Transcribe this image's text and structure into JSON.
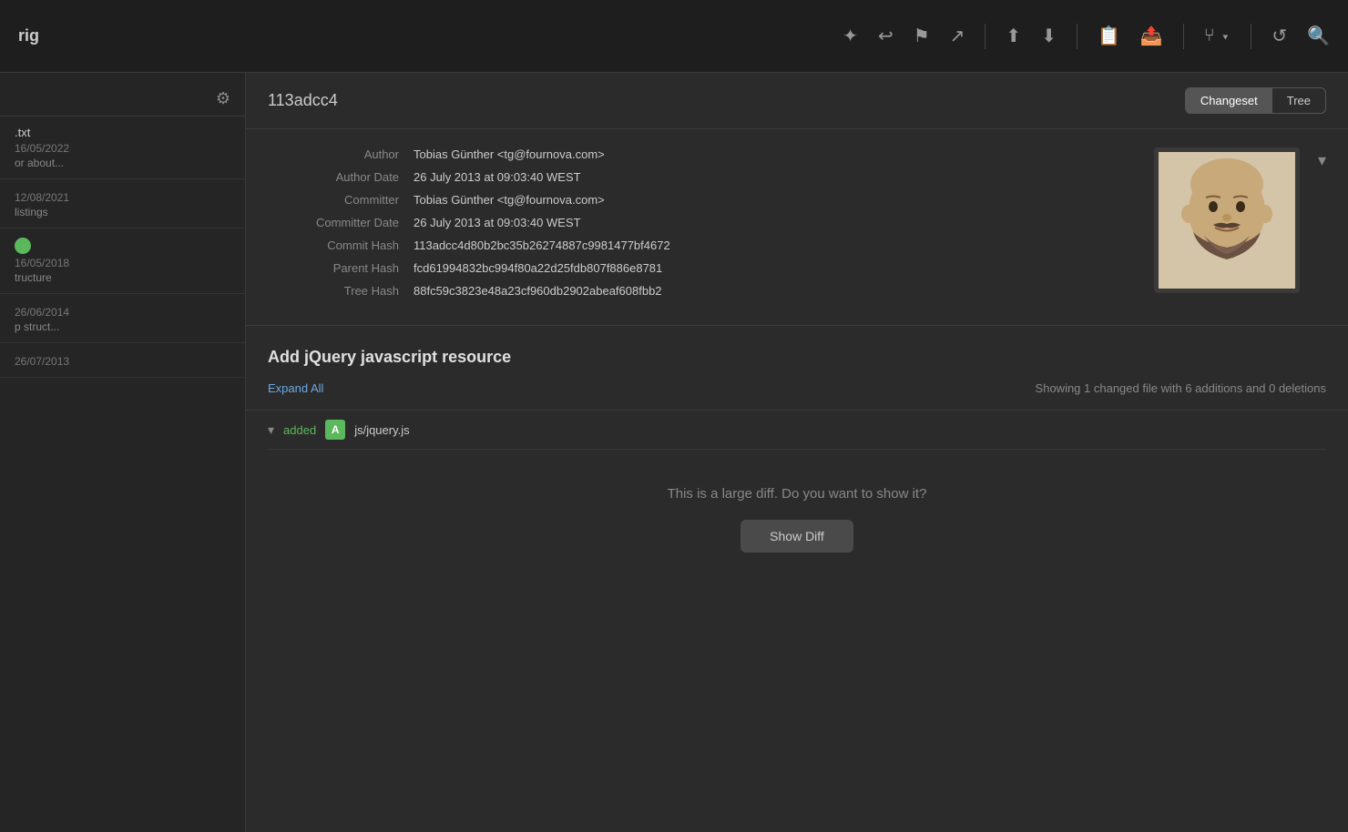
{
  "app": {
    "title": "rig"
  },
  "toolbar": {
    "icons": [
      {
        "name": "magic-wand-icon",
        "symbol": "✦"
      },
      {
        "name": "undo-icon",
        "symbol": "↩"
      },
      {
        "name": "flag-icon",
        "symbol": "⚑"
      },
      {
        "name": "merge-icon",
        "symbol": "↗"
      },
      {
        "name": "branch-up-icon",
        "symbol": "⬆"
      },
      {
        "name": "branch-down-icon",
        "symbol": "⬇"
      },
      {
        "name": "stash-icon",
        "symbol": "📋"
      },
      {
        "name": "push-icon",
        "symbol": "📤"
      },
      {
        "name": "branch-icon",
        "symbol": "⑂"
      },
      {
        "name": "refresh-icon",
        "symbol": "↺"
      },
      {
        "name": "search-icon",
        "symbol": "🔍"
      }
    ]
  },
  "sidebar": {
    "items": [
      {
        "id": 1,
        "title": ".txt",
        "date": "16/05/2022",
        "desc": "or about..."
      },
      {
        "id": 2,
        "title": "",
        "date": "12/08/2021",
        "desc": "listings"
      },
      {
        "id": 3,
        "title": "",
        "date": "16/05/2018",
        "desc": "tructure"
      },
      {
        "id": 4,
        "title": "",
        "date": "26/06/2014",
        "desc": "p struct..."
      },
      {
        "id": 5,
        "title": "",
        "date": "26/07/2013",
        "desc": ""
      }
    ]
  },
  "commit": {
    "hash": "113adcc4",
    "author_label": "Author",
    "author_value": "Tobias Günther <tg@fournova.com>",
    "author_date_label": "Author Date",
    "author_date_value": "26 July 2013 at 09:03:40 WEST",
    "committer_label": "Committer",
    "committer_value": "Tobias Günther <tg@fournova.com>",
    "committer_date_label": "Committer Date",
    "committer_date_value": "26 July 2013 at 09:03:40 WEST",
    "commit_hash_label": "Commit Hash",
    "commit_hash_value": "113adcc4d80b2bc35b26274887c9981477bf4672",
    "parent_hash_label": "Parent Hash",
    "parent_hash_value": "fcd61994832bc994f80a22d25fdb807f886e8781",
    "tree_hash_label": "Tree Hash",
    "tree_hash_value": "88fc59c3823e48a23cf960db2902abeaf608fbb2",
    "message": "Add jQuery javascript resource",
    "diff_summary": "Showing 1 changed file with 6 additions and 0 deletions",
    "expand_all": "Expand All"
  },
  "view_toggle": {
    "changeset_label": "Changeset",
    "tree_label": "Tree",
    "active": "changeset"
  },
  "file_diff": {
    "status": "added",
    "badge": "A",
    "filename": "js/jquery.js",
    "large_diff_text": "This is a large diff. Do you want to show it?",
    "show_diff_label": "Show Diff"
  }
}
